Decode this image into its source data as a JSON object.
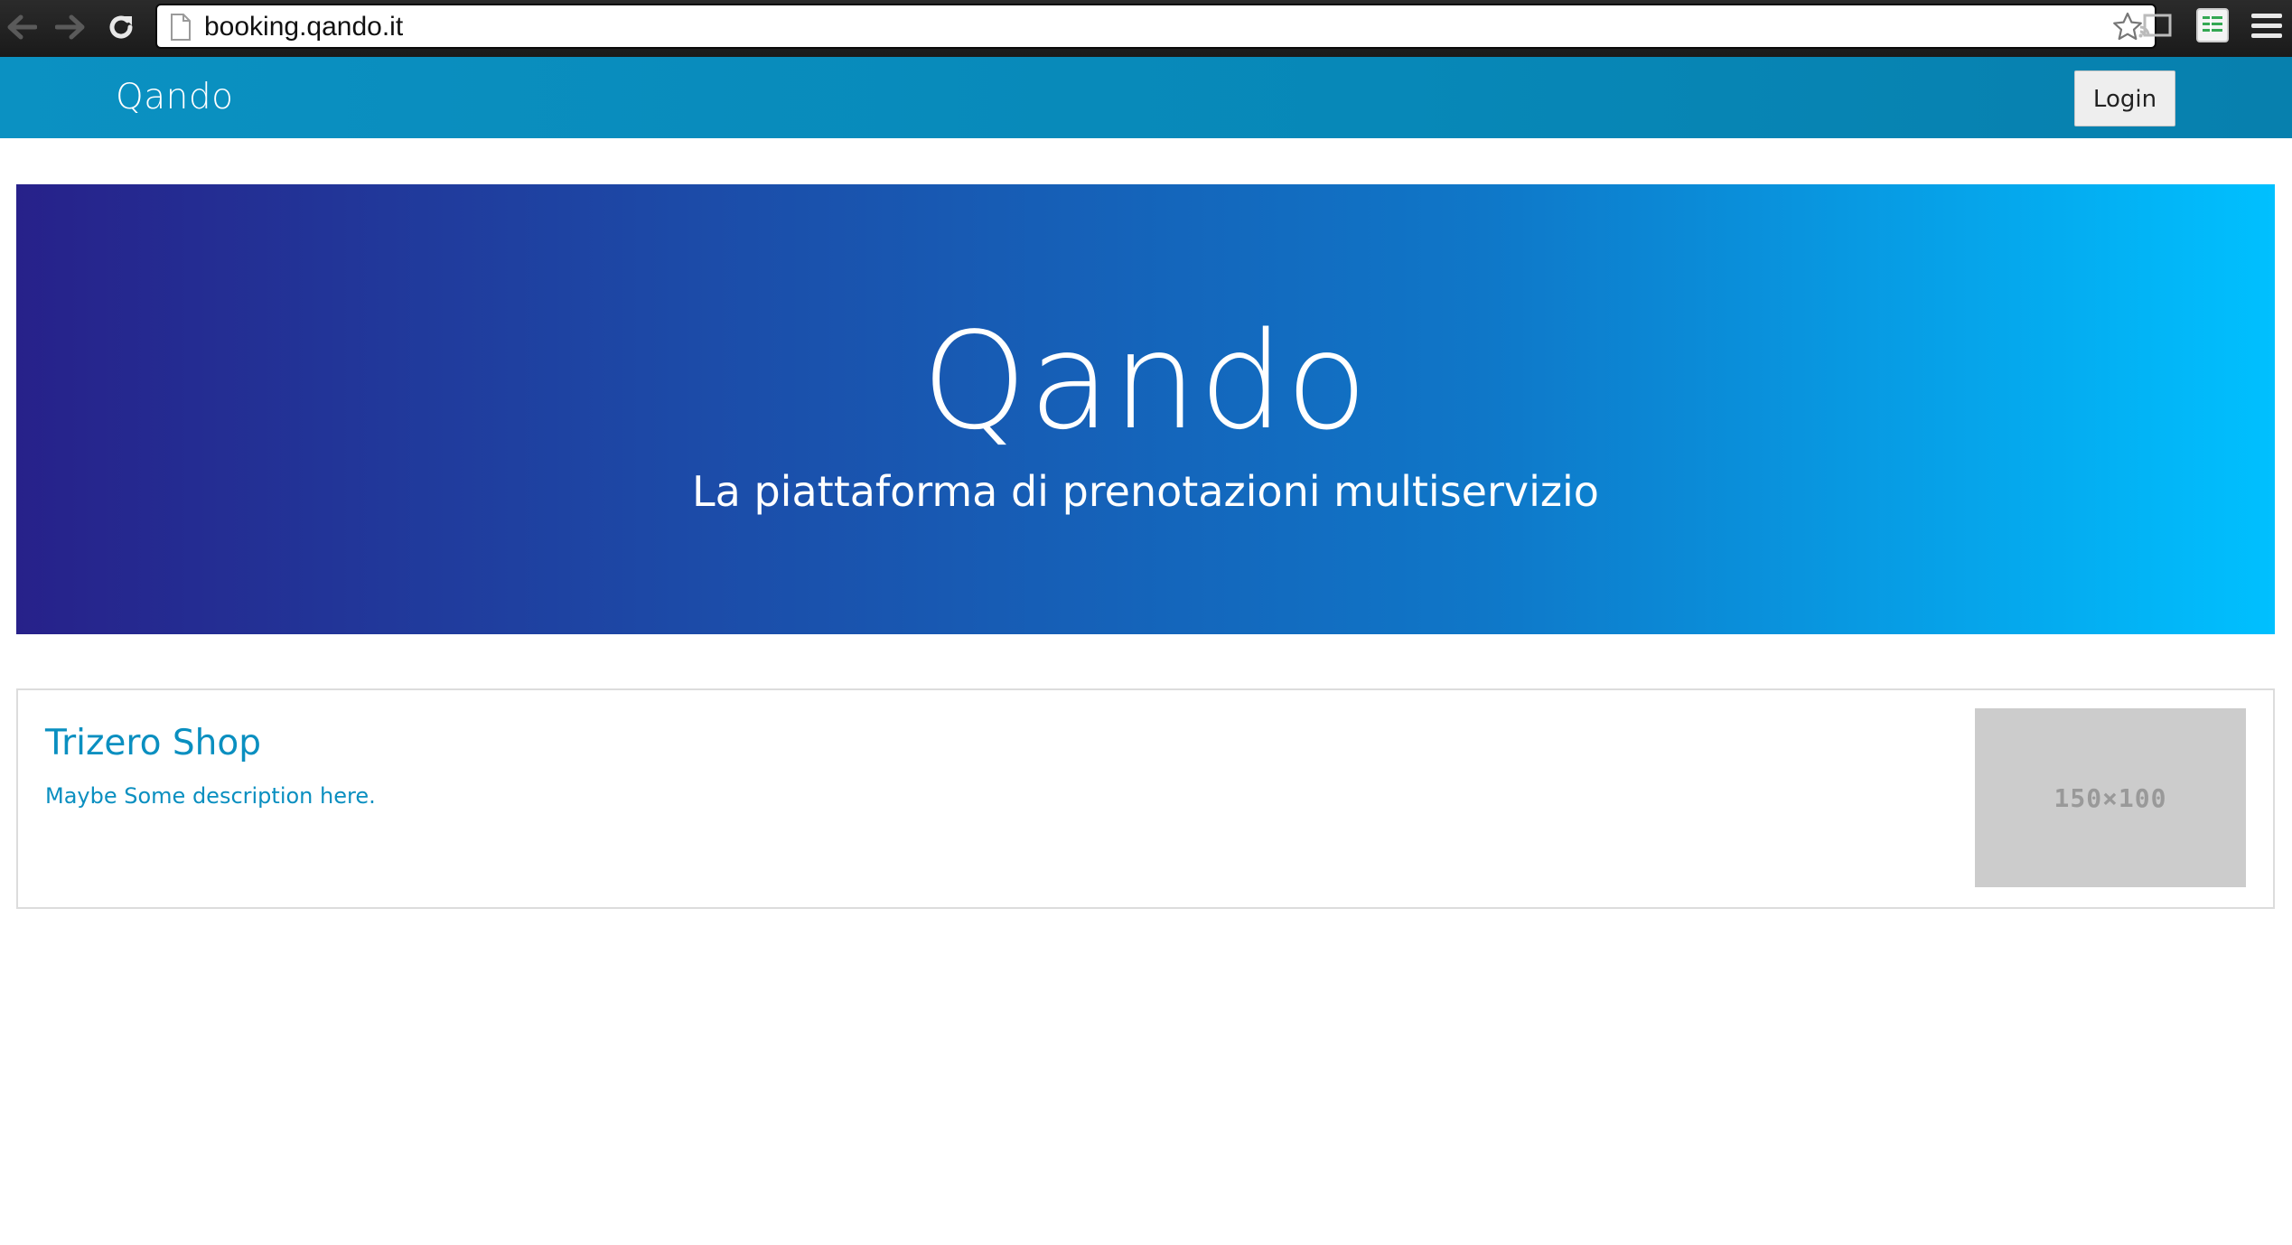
{
  "browser": {
    "url": "booking.qando.it",
    "icons": [
      "back-arrow-icon",
      "forward-arrow-icon",
      "reload-icon",
      "page-icon",
      "star-icon",
      "cast-icon",
      "sheets-extension-icon",
      "menu-icon"
    ]
  },
  "navbar": {
    "brand": "Qando",
    "login_label": "Login",
    "color": "#0788b8"
  },
  "hero": {
    "title": "Qando",
    "subtitle": "La piattaforma di prenotazioni multiservizio",
    "gradient_start": "#27218a",
    "gradient_end": "#00c0ff"
  },
  "shops": [
    {
      "name": "Trizero Shop",
      "description": "Maybe Some description here.",
      "thumbnail_label": "150×100"
    }
  ],
  "accent_color": "#0a8fc0"
}
